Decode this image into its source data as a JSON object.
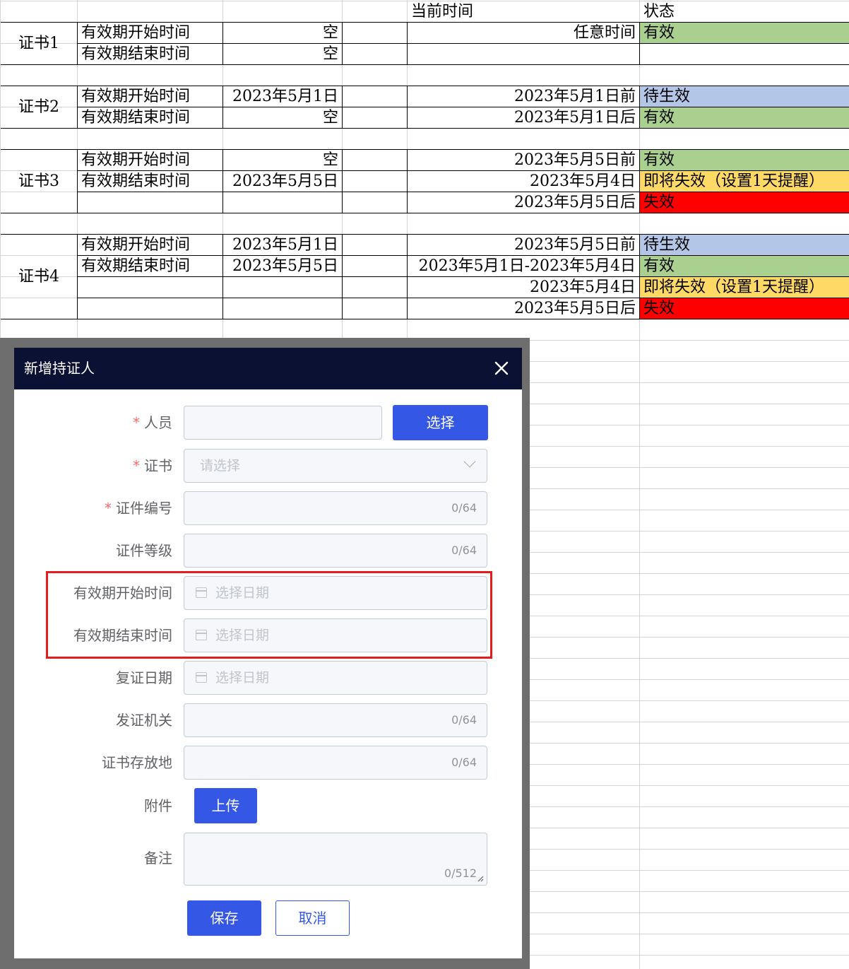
{
  "sheet": {
    "header": {
      "current_time": "当前时间",
      "status": "状态"
    },
    "cert1": {
      "name": "证书1",
      "start_label": "有效期开始时间",
      "start_value": "空",
      "end_label": "有效期结束时间",
      "end_value": "空",
      "rows": [
        {
          "time": "任意时间",
          "status": "有效"
        }
      ]
    },
    "cert2": {
      "name": "证书2",
      "start_label": "有效期开始时间",
      "start_value": "2023年5月1日",
      "end_label": "有效期结束时间",
      "end_value": "空",
      "rows": [
        {
          "time": "2023年5月1日前",
          "status": "待生效"
        },
        {
          "time": "2023年5月1日后",
          "status": "有效"
        }
      ]
    },
    "cert3": {
      "name": "证书3",
      "start_label": "有效期开始时间",
      "start_value": "空",
      "end_label": "有效期结束时间",
      "end_value": "2023年5月5日",
      "rows": [
        {
          "time": "2023年5月5日前",
          "status": "有效"
        },
        {
          "time": "2023年5月4日",
          "status": "即将失效（设置1天提醒）"
        },
        {
          "time": "2023年5月5日后",
          "status": "失效"
        }
      ]
    },
    "cert4": {
      "name": "证书4",
      "start_label": "有效期开始时间",
      "start_value": "2023年5月1日",
      "end_label": "有效期结束时间",
      "end_value": "2023年5月5日",
      "rows": [
        {
          "time": "2023年5月5日前",
          "status": "待生效"
        },
        {
          "time": "2023年5月1日-2023年5月4日",
          "status": "有效"
        },
        {
          "time": "2023年5月4日",
          "status": "即将失效（设置1天提醒）"
        },
        {
          "time": "2023年5月5日后",
          "status": "失效"
        }
      ]
    },
    "colors": {
      "valid": "#a9d08e",
      "pending": "#b4c6e7",
      "expiring": "#ffd966",
      "expired": "#ff0000"
    }
  },
  "dialog": {
    "title": "新增持证人",
    "close_icon": "close-icon",
    "person": {
      "label": "人员",
      "select_label": "选择"
    },
    "certificate": {
      "label": "证书",
      "placeholder": "请选择"
    },
    "cert_number": {
      "label": "证件编号",
      "counter": "0/64"
    },
    "cert_level": {
      "label": "证件等级",
      "counter": "0/64"
    },
    "valid_start": {
      "label": "有效期开始时间",
      "placeholder": "选择日期"
    },
    "valid_end": {
      "label": "有效期结束时间",
      "placeholder": "选择日期"
    },
    "review_date": {
      "label": "复证日期",
      "placeholder": "选择日期"
    },
    "issuer": {
      "label": "发证机关",
      "counter": "0/64"
    },
    "storage": {
      "label": "证书存放地",
      "counter": "0/64"
    },
    "attachment": {
      "label": "附件",
      "upload_label": "上传"
    },
    "remark": {
      "label": "备注",
      "counter": "0/512"
    },
    "save_label": "保存",
    "cancel_label": "取消",
    "accent_color": "#3557e6"
  }
}
